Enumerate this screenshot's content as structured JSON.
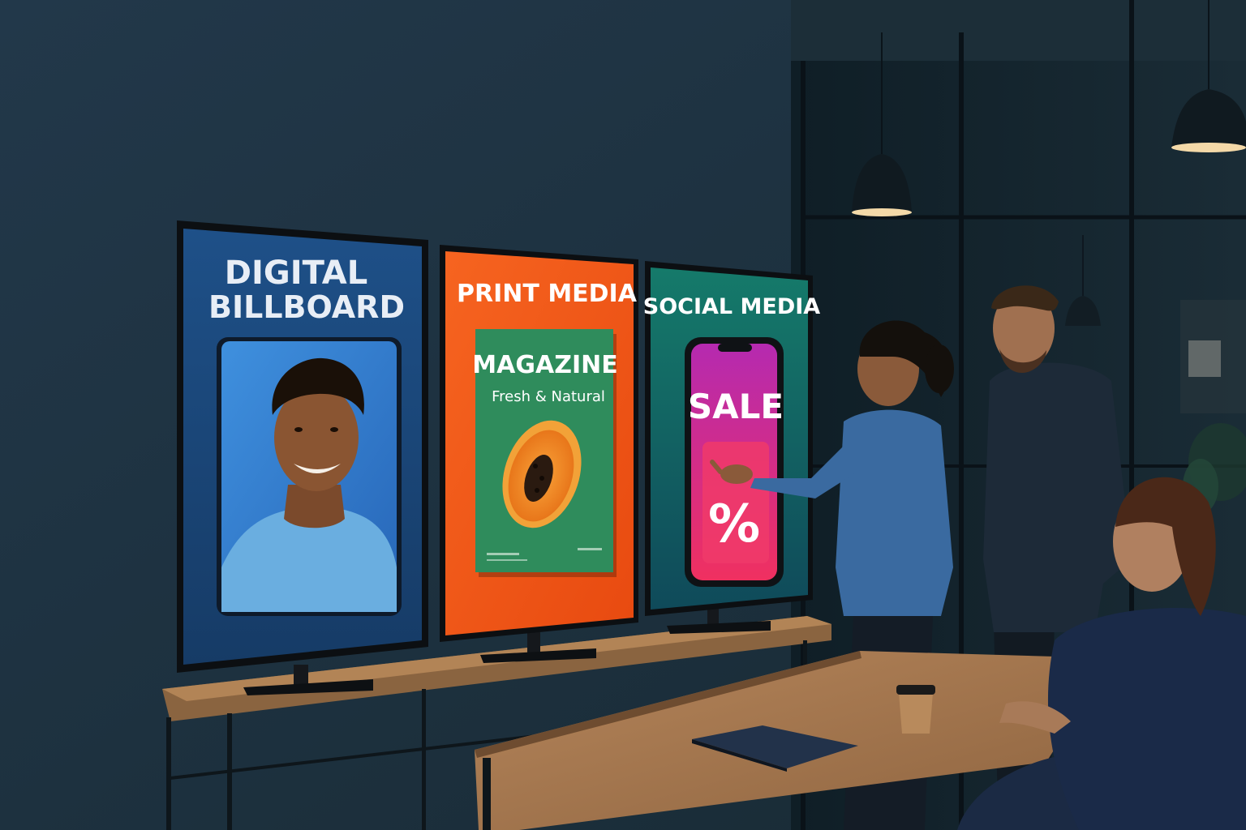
{
  "screens": {
    "billboard": {
      "title_line1": "DIGITAL",
      "title_line2": "BILLBOARD"
    },
    "print": {
      "title": "PRINT MEDIA",
      "magazine_title": "MAGAZINE",
      "magazine_subtitle": "Fresh & Natural"
    },
    "social": {
      "title": "SOCIAL MEDIA",
      "sale_text": "SALE",
      "percent_symbol": "%"
    }
  },
  "colors": {
    "wall": "#1f3340",
    "billboard_screen": "#1e4a7a",
    "print_screen": "#f25a16",
    "social_screen": "#136b60",
    "magazine_cover": "#2e8a5a",
    "phone_screen_top": "#c02aa8",
    "phone_screen_bottom": "#ee2c64",
    "table_wood": "#a87848"
  }
}
